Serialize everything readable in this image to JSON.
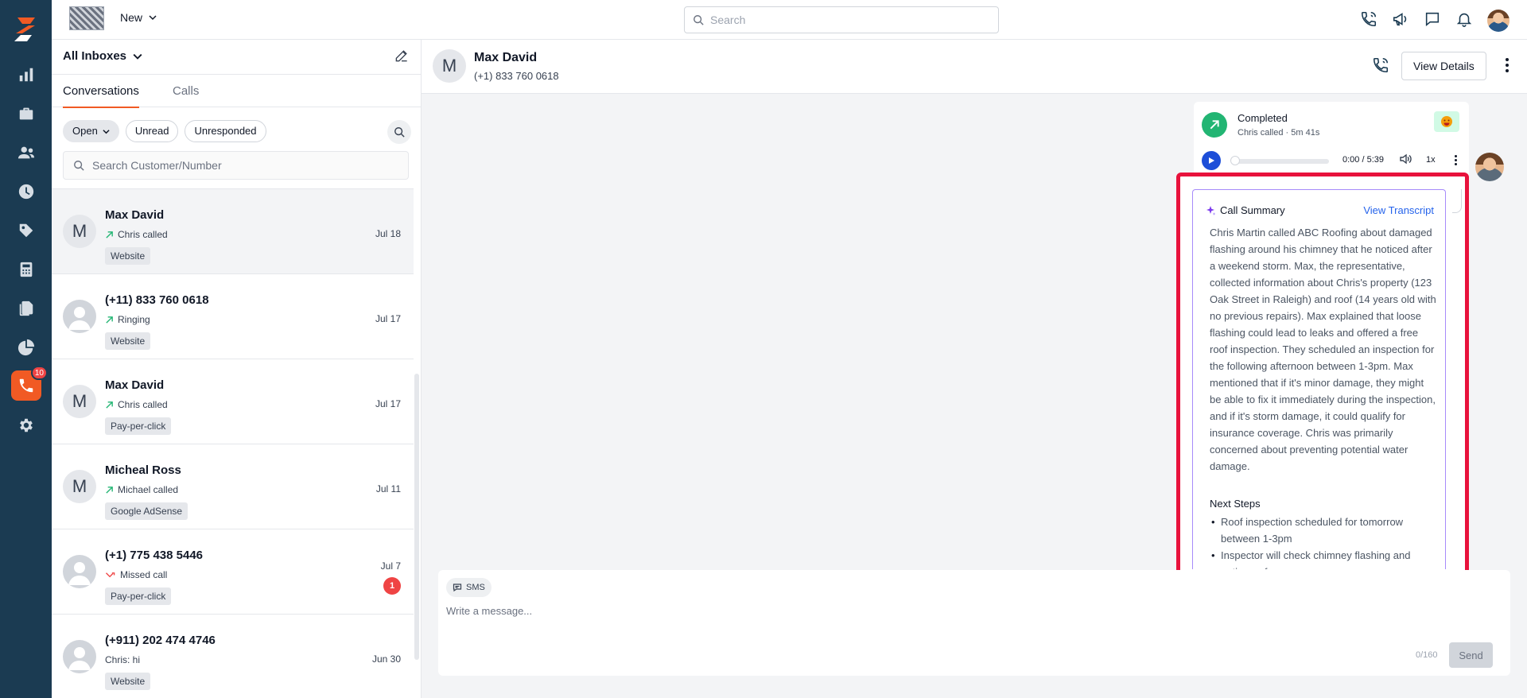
{
  "top": {
    "new_label": "New",
    "search_placeholder": "Search"
  },
  "sidebar": {
    "items": [
      {
        "name": "reports"
      },
      {
        "name": "inventory"
      },
      {
        "name": "contacts"
      },
      {
        "name": "history"
      },
      {
        "name": "tags"
      },
      {
        "name": "calculator"
      },
      {
        "name": "documents"
      },
      {
        "name": "analytics"
      },
      {
        "name": "calls",
        "badge": "10"
      },
      {
        "name": "settings"
      }
    ]
  },
  "list": {
    "inbox_label": "All Inboxes",
    "tabs": [
      "Conversations",
      "Calls"
    ],
    "filters": [
      "Open",
      "Unread",
      "Unresponded"
    ],
    "search_placeholder": "Search Customer/Number",
    "rows": [
      {
        "name": "Max David",
        "initial": "M",
        "sub": "Chris called",
        "date": "Jul 18",
        "tag": "Website"
      },
      {
        "name": "(+11) 833 760 0618",
        "sub": "Ringing",
        "date": "Jul 17",
        "tag": "Website"
      },
      {
        "name": "Max David",
        "initial": "M",
        "sub": "Chris called",
        "date": "Jul 17",
        "tag": "Pay-per-click"
      },
      {
        "name": "Micheal Ross",
        "initial": "M",
        "sub": "Michael called",
        "date": "Jul 11",
        "tag": "Google AdSense"
      },
      {
        "name": "(+1) 775 438 5446",
        "sub": "Missed call",
        "date": "Jul 7",
        "tag": "Pay-per-click",
        "unread": "1"
      },
      {
        "name": "(+911) 202 474 4746",
        "sub": "Chris: hi",
        "date": "Jun 30",
        "tag": "Website"
      }
    ]
  },
  "chat": {
    "initial": "M",
    "name": "Max David",
    "phone": "(+1) 833 760 0618",
    "view_details": "View Details"
  },
  "call": {
    "status": "Completed",
    "detail": "Chris called · 5m 41s",
    "time": "0:00 / 5:39",
    "speed": "1x",
    "progress": 0
  },
  "summary": {
    "title": "Call Summary",
    "transcript_link": "View Transcript",
    "text": "Chris Martin called ABC Roofing about damaged flashing around his chimney that he noticed after a weekend storm. Max, the representative, collected information about Chris's property (123 Oak Street in Raleigh) and roof (14 years old with no previous repairs). Max explained that loose flashing could lead to leaks and offered a free roof inspection. They scheduled an inspection for the following afternoon between 1-3pm. Max mentioned that if it's minor damage, they might be able to fix it immediately during the inspection, and if it's storm damage, it could qualify for insurance coverage. Chris was primarily concerned about preventing potential water damage.",
    "next_steps_title": "Next Steps",
    "next_steps": [
      "Roof inspection scheduled for tomorrow between 1-3pm",
      "Inspector will check chimney flashing and entire roof"
    ]
  },
  "composer": {
    "channel": "SMS",
    "placeholder": "Write a message...",
    "counter": "0/160",
    "send": "Send"
  },
  "colors": {
    "sidebar": "#1b3b52",
    "accent": "#f15a24",
    "highlight": "#e8123c",
    "completed": "#22b573",
    "link": "#2563eb"
  }
}
